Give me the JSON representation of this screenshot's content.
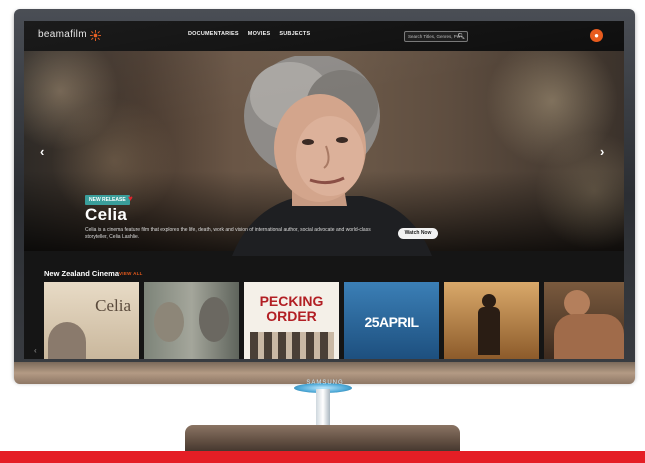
{
  "tv": {
    "brand": "SAMSUNG"
  },
  "nav": {
    "logo": "beamafilm",
    "links": [
      "DOCUMENTARIES",
      "MOVIES",
      "SUBJECTS"
    ],
    "search_placeholder": "Search Titles, Genres, Per",
    "search_icon": "search-icon",
    "account_icon": "user-icon"
  },
  "hero": {
    "badge": "NEW RELEASE",
    "title": "Celia",
    "description": "Celia is a cinema feature film that explores the life, death, work and vision of international author, social advocate and world-class storyteller, Celia Lashlie.",
    "cta": "Watch Now",
    "prev_icon": "chevron-left-icon",
    "next_icon": "chevron-right-icon"
  },
  "row": {
    "title": "New Zealand Cinema",
    "view_all": "VIEW ALL",
    "tiles": [
      {
        "title": "Celia"
      },
      {
        "title": ""
      },
      {
        "title": "PECKING ORDER"
      },
      {
        "title": "25APRIL"
      },
      {
        "title": ""
      },
      {
        "title": ""
      }
    ]
  },
  "colors": {
    "accent": "#e85a1c",
    "badge": "#3a9e9b",
    "red_bar": "#e51e25"
  }
}
